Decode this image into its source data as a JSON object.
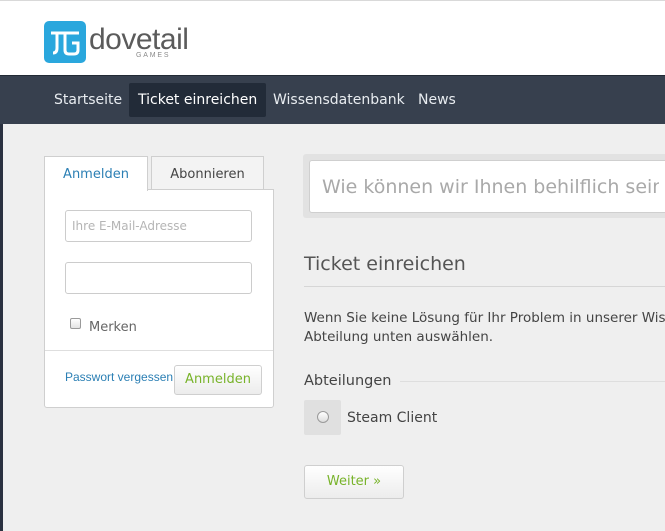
{
  "logo": {
    "word": "dovetail",
    "sub": "GAMES"
  },
  "nav": {
    "items": [
      {
        "label": "Startseite"
      },
      {
        "label": "Ticket einreichen"
      },
      {
        "label": "Wissensdatenbank"
      },
      {
        "label": "News"
      }
    ],
    "active_index": 1
  },
  "login": {
    "tabs": [
      {
        "label": "Anmelden"
      },
      {
        "label": "Abonnieren"
      }
    ],
    "email_placeholder": "Ihre E-Mail-Adresse",
    "password_value": "",
    "remember_label": "Merken",
    "forgot_label": "Passwort vergessen",
    "submit_label": "Anmelden"
  },
  "search": {
    "placeholder": "Wie können wir Ihnen behilflich sein?"
  },
  "ticket": {
    "title": "Ticket einreichen",
    "intro_line1": "Wenn Sie keine Lösung für Ihr Problem in unserer Wissensdatenbank",
    "intro_line2": "Abteilung unten auswählen.",
    "departments_title": "Abteilungen",
    "departments": [
      {
        "label": "Steam Client"
      }
    ],
    "next_label": "Weiter »"
  },
  "colors": {
    "nav_bg": "#37404e",
    "accent_blue": "#2b7fb4",
    "accent_green": "#78b32a",
    "logo_blue": "#2aa7dd"
  }
}
